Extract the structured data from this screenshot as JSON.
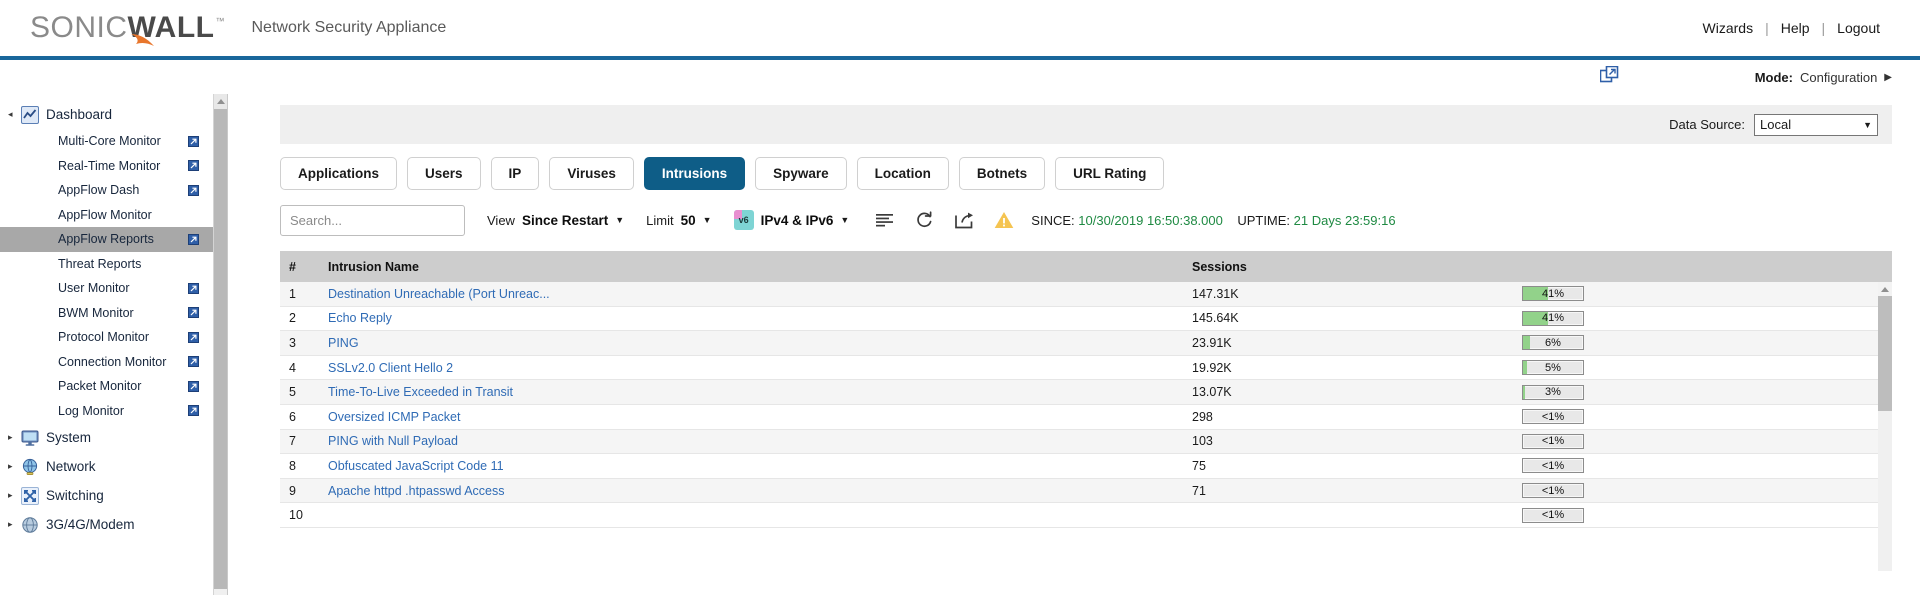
{
  "brand": {
    "logo_sonic": "SONIC",
    "logo_wall": "WALL",
    "logo_tm": "™",
    "appliance": "Network Security Appliance"
  },
  "topnav": {
    "wizards": "Wizards",
    "help": "Help",
    "logout": "Logout",
    "separator": "|"
  },
  "modebar": {
    "popout_icon": "windows-popout-icon",
    "mode_label": "Mode:",
    "mode_value": "Configuration",
    "mode_caret": "▶"
  },
  "datasource": {
    "label": "Data Source:",
    "value": "Local",
    "caret": "▼",
    "options": [
      "Local"
    ]
  },
  "sidebar": {
    "scroll_up_icon": "scroll-up-arrow-icon",
    "groups": [
      {
        "label": "Dashboard",
        "icon": "dashboard-chart-icon",
        "arrow": "◂",
        "expanded": true,
        "items": [
          {
            "label": "Multi-Core Monitor",
            "external": true,
            "active": false
          },
          {
            "label": "Real-Time Monitor",
            "external": true,
            "active": false
          },
          {
            "label": "AppFlow Dash",
            "external": true,
            "active": false
          },
          {
            "label": "AppFlow Monitor",
            "external": false,
            "active": false
          },
          {
            "label": "AppFlow Reports",
            "external": true,
            "active": true
          },
          {
            "label": "Threat Reports",
            "external": false,
            "active": false
          },
          {
            "label": "User Monitor",
            "external": true,
            "active": false
          },
          {
            "label": "BWM Monitor",
            "external": true,
            "active": false
          },
          {
            "label": "Protocol Monitor",
            "external": true,
            "active": false
          },
          {
            "label": "Connection Monitor",
            "external": true,
            "active": false
          },
          {
            "label": "Packet Monitor",
            "external": true,
            "active": false
          },
          {
            "label": "Log Monitor",
            "external": true,
            "active": false
          }
        ]
      },
      {
        "label": "System",
        "icon": "monitor-screen-icon",
        "arrow": "▸",
        "expanded": false,
        "items": []
      },
      {
        "label": "Network",
        "icon": "globe-icon",
        "arrow": "▸",
        "expanded": false,
        "items": []
      },
      {
        "label": "Switching",
        "icon": "switching-arrows-icon",
        "arrow": "▸",
        "expanded": false,
        "items": []
      },
      {
        "label": "3G/4G/Modem",
        "icon": "modem-globe-icon",
        "arrow": "▸",
        "expanded": false,
        "items": []
      }
    ]
  },
  "tabs": [
    {
      "label": "Applications",
      "active": false
    },
    {
      "label": "Users",
      "active": false
    },
    {
      "label": "IP",
      "active": false
    },
    {
      "label": "Viruses",
      "active": false
    },
    {
      "label": "Intrusions",
      "active": true
    },
    {
      "label": "Spyware",
      "active": false
    },
    {
      "label": "Location",
      "active": false
    },
    {
      "label": "Botnets",
      "active": false
    },
    {
      "label": "URL Rating",
      "active": false
    }
  ],
  "toolbar": {
    "search_placeholder": "Search...",
    "view_label": "View",
    "view_value": "Since Restart",
    "limit_label": "Limit",
    "limit_value": "50",
    "ip_badge": "v6",
    "ip_version_value": "IPv4 & IPv6",
    "caret": "▼",
    "icons": [
      {
        "name": "list-lines-icon"
      },
      {
        "name": "refresh-icon"
      },
      {
        "name": "export-share-icon"
      },
      {
        "name": "warning-triangle-icon"
      }
    ],
    "since_label": "SINCE:",
    "since_value": "10/30/2019 16:50:38.000",
    "uptime_label": "UPTIME:",
    "uptime_value": "21 Days 23:59:16"
  },
  "table": {
    "columns": [
      "#",
      "Intrusion Name",
      "Sessions",
      ""
    ],
    "rows": [
      {
        "num": "1",
        "name": "Destination Unreachable (Port Unreac...",
        "sessions": "147.31K",
        "pct_text": "41%",
        "pct_fill": 41
      },
      {
        "num": "2",
        "name": "Echo Reply",
        "sessions": "145.64K",
        "pct_text": "41%",
        "pct_fill": 41
      },
      {
        "num": "3",
        "name": "PING",
        "sessions": "23.91K",
        "pct_text": "6%",
        "pct_fill": 11
      },
      {
        "num": "4",
        "name": "SSLv2.0 Client Hello 2",
        "sessions": "19.92K",
        "pct_text": "5%",
        "pct_fill": 6
      },
      {
        "num": "5",
        "name": "Time-To-Live Exceeded in Transit",
        "sessions": "13.07K",
        "pct_text": "3%",
        "pct_fill": 4
      },
      {
        "num": "6",
        "name": "Oversized ICMP Packet",
        "sessions": "298",
        "pct_text": "<1%",
        "pct_fill": 0
      },
      {
        "num": "7",
        "name": "PING with Null Payload",
        "sessions": "103",
        "pct_text": "<1%",
        "pct_fill": 0
      },
      {
        "num": "8",
        "name": "Obfuscated JavaScript Code 11",
        "sessions": "75",
        "pct_text": "<1%",
        "pct_fill": 0
      },
      {
        "num": "9",
        "name": "Apache httpd .htpasswd Access",
        "sessions": "71",
        "pct_text": "<1%",
        "pct_fill": 0
      },
      {
        "num": "10",
        "name": "",
        "sessions": "",
        "pct_text": "<1%",
        "pct_fill": 0
      }
    ],
    "scroll_up_icon": "scroll-up-arrow-icon"
  },
  "colors": {
    "brand_blue": "#19679b",
    "tab_active": "#0e5d87",
    "link_blue": "#2f6bb5",
    "green_value": "#1f8a43",
    "bar_green": "#92d28a",
    "warning_amber": "#f5c451"
  }
}
